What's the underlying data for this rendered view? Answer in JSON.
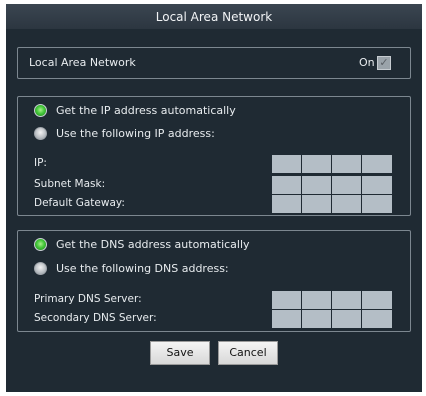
{
  "window": {
    "title": "Local Area Network"
  },
  "lan": {
    "label": "Local Area Network",
    "state_label": "On",
    "checked": true
  },
  "ip": {
    "auto_label": "Get the IP address automatically",
    "manual_label": "Use the following IP address:",
    "selected": "auto",
    "fields": [
      {
        "label": "IP:",
        "octets": [
          "",
          "",
          "",
          ""
        ]
      },
      {
        "label": "Subnet Mask:",
        "octets": [
          "",
          "",
          "",
          ""
        ]
      },
      {
        "label": "Default Gateway:",
        "octets": [
          "",
          "",
          "",
          ""
        ]
      }
    ]
  },
  "dns": {
    "auto_label": "Get the DNS address automatically",
    "manual_label": "Use the following DNS address:",
    "selected": "auto",
    "fields": [
      {
        "label": "Primary DNS Server:",
        "octets": [
          "",
          "",
          "",
          ""
        ]
      },
      {
        "label": "Secondary DNS Server:",
        "octets": [
          "",
          "",
          "",
          ""
        ]
      }
    ]
  },
  "buttons": {
    "save": "Save",
    "cancel": "Cancel"
  },
  "colors": {
    "background": "#1f2a33",
    "accent_radio": "#44c83a",
    "ip_box": "#b4bec6"
  }
}
